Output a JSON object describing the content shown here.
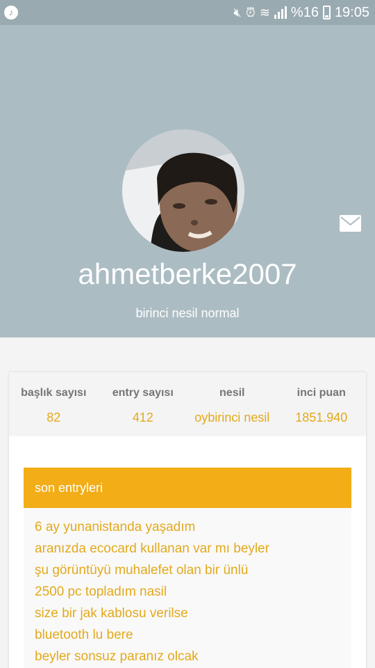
{
  "status_bar": {
    "battery_text": "%16",
    "time": "19:05",
    "icons": [
      "music-note-icon",
      "mute-icon",
      "alarm-icon",
      "wifi-icon",
      "signal-icon",
      "battery-icon"
    ]
  },
  "profile": {
    "username": "ahmetberke2007",
    "subtitle": "birinci nesil normal",
    "header_color": "#acbcc3",
    "icons": [
      "mail-icon"
    ]
  },
  "stats": [
    {
      "label": "başlık sayısı",
      "value": "82"
    },
    {
      "label": "entry sayısı",
      "value": "412"
    },
    {
      "label": "nesil",
      "value": "oybirinci nesil"
    },
    {
      "label": "inci puan",
      "value": "1851.940"
    }
  ],
  "entries": {
    "title": "son entryleri",
    "accent_color": "#f2ad17",
    "items": [
      "6 ay yunanistanda yaşadım",
      "aranızda ecocard kullanan var mı beyler",
      "şu görüntüyü muhalefet olan bir ünlü",
      "2500 pc topladım nasil",
      "size bir jak kablosu verilse",
      "bluetooth lu bere",
      "beyler sonsuz paranız olcak"
    ]
  }
}
